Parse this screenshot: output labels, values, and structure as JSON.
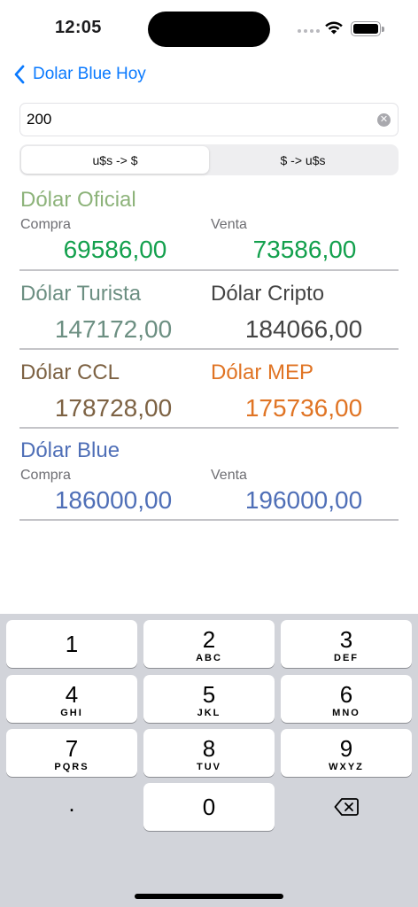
{
  "status": {
    "time": "12:05"
  },
  "nav": {
    "back_label": "Dolar Blue Hoy"
  },
  "search": {
    "value": "200"
  },
  "segments": {
    "first": "u$s -> $",
    "second": "$ -> u$s",
    "selected": "u$s -> $"
  },
  "rates": {
    "oficial": {
      "title": "Dólar Oficial",
      "buy_label": "Compra",
      "buy": "69586,00",
      "sell_label": "Venta",
      "sell": "73586,00"
    },
    "turista": {
      "title": "Dólar Turista",
      "value": "147172,00"
    },
    "cripto": {
      "title": "Dólar Cripto",
      "value": "184066,00"
    },
    "ccl": {
      "title": "Dólar CCL",
      "value": "178728,00"
    },
    "mep": {
      "title": "Dólar MEP",
      "value": "175736,00"
    },
    "blue": {
      "title": "Dólar Blue",
      "buy_label": "Compra",
      "buy": "186000,00",
      "sell_label": "Venta",
      "sell": "196000,00"
    }
  },
  "keyboard": {
    "k1": {
      "num": "1",
      "letters": ""
    },
    "k2": {
      "num": "2",
      "letters": "ABC"
    },
    "k3": {
      "num": "3",
      "letters": "DEF"
    },
    "k4": {
      "num": "4",
      "letters": "GHI"
    },
    "k5": {
      "num": "5",
      "letters": "JKL"
    },
    "k6": {
      "num": "6",
      "letters": "MNO"
    },
    "k7": {
      "num": "7",
      "letters": "PQRS"
    },
    "k8": {
      "num": "8",
      "letters": "TUV"
    },
    "k9": {
      "num": "9",
      "letters": "WXYZ"
    },
    "k0": {
      "num": "0"
    },
    "decimal": "."
  },
  "icons": {
    "back": "chevron-left-icon",
    "clear": "clear-circle-icon",
    "delete": "backspace-icon",
    "wifi": "wifi-icon",
    "battery": "battery-icon",
    "signal": "cellular-signal-icon"
  },
  "colors": {
    "accent": "#0a7aff",
    "oficial_title": "#8db37a",
    "oficial_values": "#13a04d",
    "turista": "#6c8f82",
    "cripto": "#444444",
    "ccl": "#7d6243",
    "mep": "#e07424",
    "blue": "#4f6fb7"
  }
}
